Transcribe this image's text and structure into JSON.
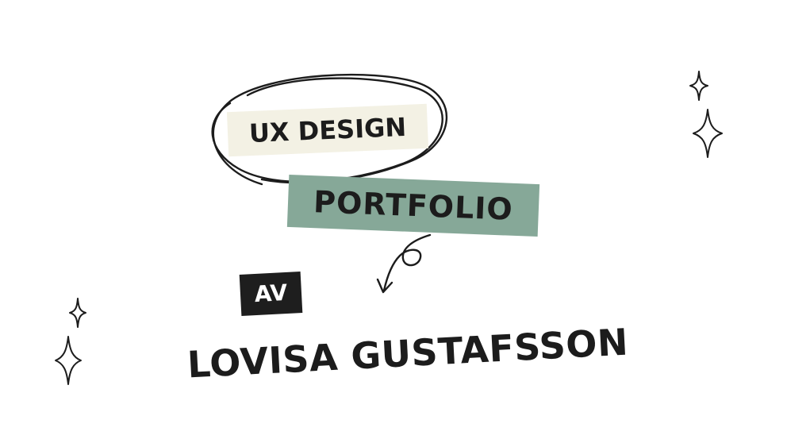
{
  "slide": {
    "title_line1": "UX DESIGN",
    "title_line2": "PORTFOLIO",
    "by_label": "AV",
    "author_name": "LOVISA GUSTAFSSON"
  },
  "colors": {
    "background": "#ffffff",
    "cream_highlight": "#f3f1e4",
    "sage_highlight": "#86a898",
    "dark_box": "#1e1e1e",
    "ink": "#1c1c1c"
  },
  "icons": [
    "sparkle-icon",
    "curly-arrow-icon",
    "hand-drawn-ellipse"
  ]
}
